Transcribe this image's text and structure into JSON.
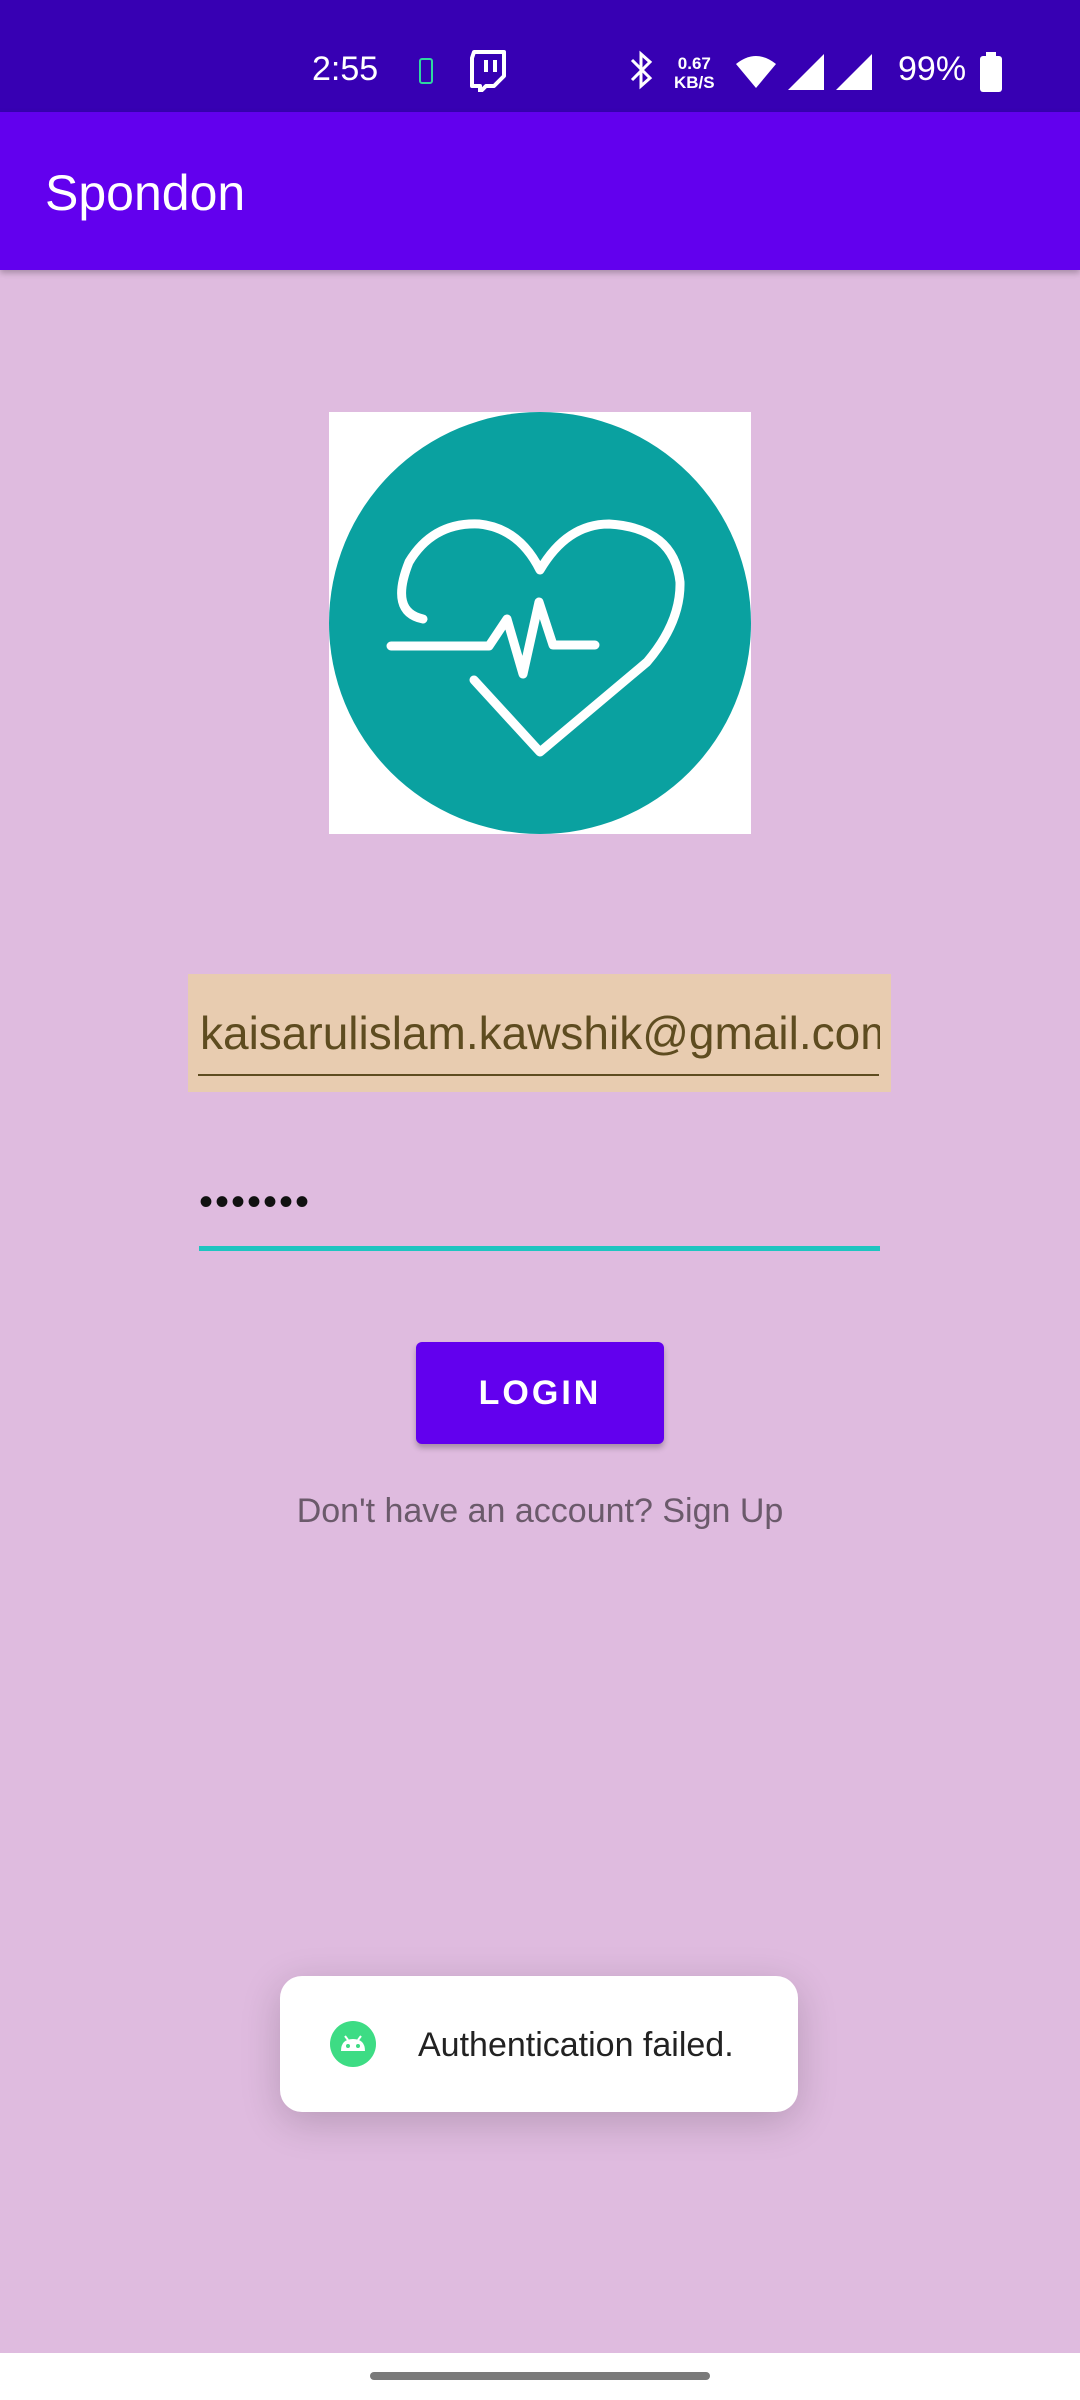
{
  "status_bar": {
    "time": "2:55",
    "network_speed": "0.67",
    "network_speed_unit": "KB/S",
    "battery_percent": "99%",
    "icons": [
      "battery-saver-icon",
      "twitch-icon",
      "bluetooth-icon",
      "wifi-icon",
      "signal-icon",
      "signal-icon",
      "battery-icon"
    ]
  },
  "app_bar": {
    "title": "Spondon"
  },
  "logo": {
    "icon": "heart-pulse-icon",
    "colors": {
      "circle": "#0aa1a0",
      "stroke": "#ffffff"
    }
  },
  "email_field": {
    "value": "kaisarulislam.kawshik@gmail.com"
  },
  "password_field": {
    "value": "•••••••"
  },
  "login_button": {
    "label": "LOGIN"
  },
  "signup_link": {
    "text": "Don't have an account? Sign Up"
  },
  "toast": {
    "message": "Authentication failed.",
    "icon": "android-icon"
  },
  "colors": {
    "status_bar": "#3700b3",
    "primary": "#6200ee",
    "background": "#dfbbdf",
    "autofill": "#e8ccb0",
    "accent": "#1ec4c0"
  }
}
